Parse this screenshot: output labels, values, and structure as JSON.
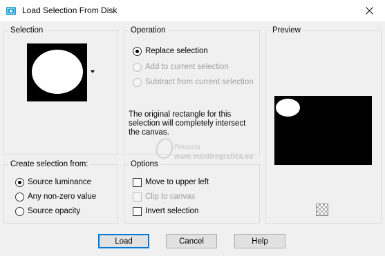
{
  "window": {
    "title": "Load Selection From Disk",
    "icons": {
      "app": "selection-icon",
      "close": "close-icon"
    }
  },
  "selection_group": {
    "title": "Selection",
    "thumbnail": "white-oval-on-black",
    "dropdown_icon": "chevron-down-icon"
  },
  "operation_group": {
    "title": "Operation",
    "options": [
      {
        "label": "Replace selection",
        "checked": true,
        "enabled": true
      },
      {
        "label": "Add to current selection",
        "checked": false,
        "enabled": false
      },
      {
        "label": "Subtract from current selection",
        "checked": false,
        "enabled": false
      }
    ],
    "message": "The original rectangle for this selection will completely intersect the canvas."
  },
  "preview_group": {
    "title": "Preview",
    "transparency_icon": "checkerboard-icon"
  },
  "create_group": {
    "title": "Create selection from:",
    "options": [
      {
        "label": "Source luminance",
        "checked": true
      },
      {
        "label": "Any non-zero value",
        "checked": false
      },
      {
        "label": "Source opacity",
        "checked": false
      }
    ]
  },
  "options_group": {
    "title": "Options",
    "items": [
      {
        "label": "Move to upper left",
        "checked": false,
        "enabled": true
      },
      {
        "label": "Clip to canvas",
        "checked": false,
        "enabled": false
      },
      {
        "label": "Invert selection",
        "checked": false,
        "enabled": true
      }
    ]
  },
  "watermark": {
    "name": "Pinuccia",
    "url": "www.maidiregrafica.eu"
  },
  "buttons": {
    "load": "Load",
    "cancel": "Cancel",
    "help": "Help"
  },
  "colors": {
    "accent": "#0078d7",
    "dialog_bg": "#f0f0f0",
    "disabled_text": "#a0a0a0"
  }
}
